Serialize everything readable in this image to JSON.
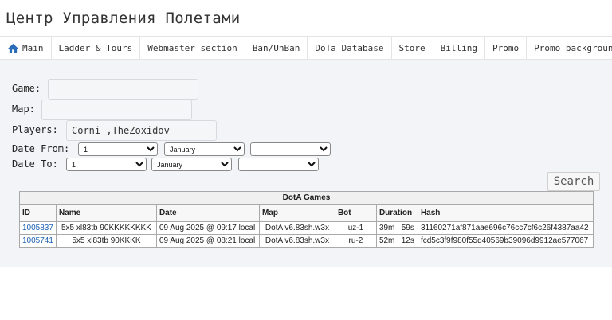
{
  "app_title": "Центр Управления Полетами",
  "nav": [
    {
      "label": "Main",
      "icon": "home-icon"
    },
    {
      "label": "Ladder & Tours"
    },
    {
      "label": "Webmaster section"
    },
    {
      "label": "Ban/UnBan"
    },
    {
      "label": "DoTa Database"
    },
    {
      "label": "Store"
    },
    {
      "label": "Billing"
    },
    {
      "label": "Promo"
    },
    {
      "label": "Promo background"
    }
  ],
  "form": {
    "game_label": "Game:",
    "game_value": "",
    "map_label": "Map:",
    "map_value": "",
    "players_label": "Players:",
    "players_value": "Corni ,TheZoxidov",
    "date_from_label": "Date From:",
    "date_to_label": "Date To:",
    "date_from": {
      "day": "1",
      "month": "January",
      "year": ""
    },
    "date_to": {
      "day": "1",
      "month": "January",
      "year": ""
    },
    "search_label": "Search"
  },
  "table": {
    "caption": "DotA Games",
    "headers": [
      "ID",
      "Name",
      "Date",
      "Map",
      "Bot",
      "Duration",
      "Hash"
    ],
    "rows": [
      [
        "1005837",
        "5x5 xl83tb 90KKKKKKKK",
        "09 Aug 2025 @ 09:17 local",
        "DotA v6.83sh.w3x",
        "uz-1",
        "39m : 59s",
        "31160271af871aae696c76cc7cf6c26f4387aa42"
      ],
      [
        "1005741",
        "5x5 xl83tb 90KKKK",
        "09 Aug 2025 @ 08:21 local",
        "DotA v6.83sh.w3x",
        "ru-2",
        "52m : 12s",
        "fcd5c3f9f980f55d40569b39096d9912ae577067"
      ]
    ]
  },
  "colors": {
    "link": "#1a5fb4",
    "icon": "#2a6cb8",
    "panel_bg": "#f2f4f7"
  }
}
